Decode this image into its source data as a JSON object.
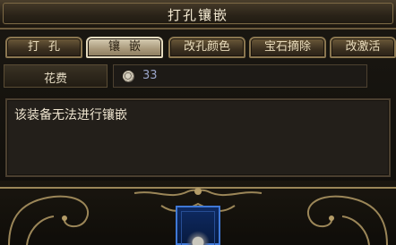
{
  "window": {
    "title": "打孔镶嵌"
  },
  "tabs": [
    {
      "label": "打孔",
      "active": false
    },
    {
      "label": "镶嵌",
      "active": true
    },
    {
      "label": "改孔颜色",
      "active": false
    },
    {
      "label": "宝石摘除",
      "active": false
    },
    {
      "label": "改激活",
      "active": false
    }
  ],
  "cost": {
    "label": "花费",
    "value": "33",
    "icon": "coin-icon"
  },
  "message": "该装备无法进行镶嵌",
  "slot": {
    "icon": "equipment-slot-icon"
  },
  "colors": {
    "active_tab": "#d9cfb6",
    "slot_border": "#3f78d6",
    "cost_value": "#9aa4c8"
  }
}
